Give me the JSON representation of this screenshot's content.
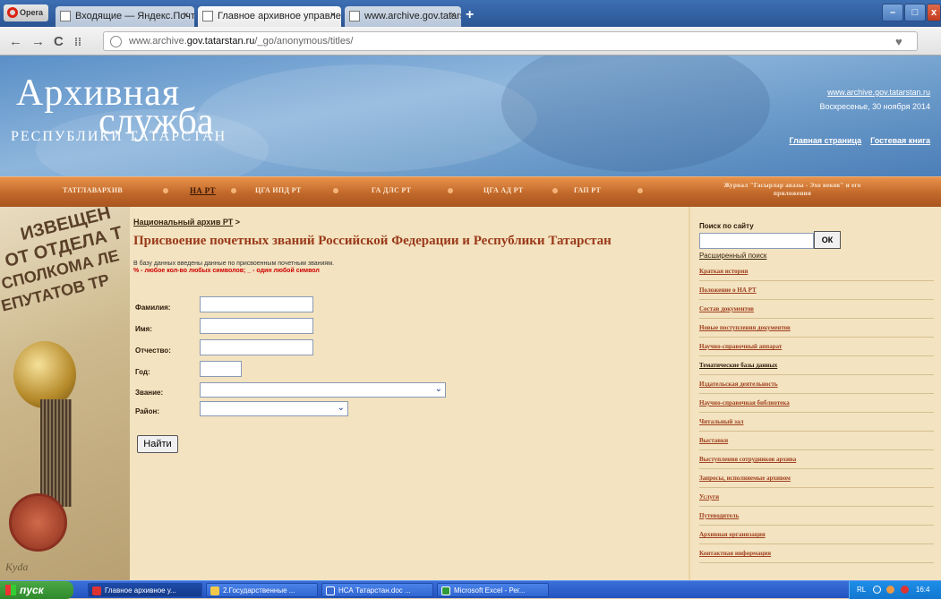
{
  "browser": {
    "opera_label": "Opera",
    "tabs": [
      {
        "label": "Входящие — Яндекс.Почта",
        "active": false
      },
      {
        "label": "Главное архивное управле",
        "active": true
      },
      {
        "label": "www.archive.gov.tatarstan",
        "active": false
      }
    ],
    "new_tab": "+",
    "url_prefix": "www.archive.",
    "url_domain": "gov.tatarstan.ru",
    "url_path": "/_go/anonymous/titles/",
    "heart": "♥",
    "win_min": "–",
    "win_max": "□",
    "win_close": "x",
    "back": "←",
    "forward": "→",
    "reload": "C",
    "speed_dial": "⁞⁞"
  },
  "banner": {
    "logo_line1": "Архивная",
    "logo_line2": "служба",
    "logo_line3": "РЕСПУБЛИКИ  ТАТАРСТАН",
    "site_url": "www.archive.gov.tatarstan.ru",
    "date": "Воскресенье, 30 ноября 2014",
    "home_link": "Главная страница",
    "guestbook_link": "Гостевая книга"
  },
  "menu": [
    {
      "label": "ТАТГЛАВАРХИВ",
      "current": false
    },
    {
      "label": "НА РТ",
      "current": true
    },
    {
      "label": "ЦГА ИПД РТ",
      "current": false
    },
    {
      "label": "ГА ДЛС РТ",
      "current": false
    },
    {
      "label": "ЦГА АД РТ",
      "current": false
    },
    {
      "label": "ГАП РТ",
      "current": false
    }
  ],
  "menu_journal": "Журнал \"Гасырлар авазы - Эхо веков\" и его приложения",
  "left_image": {
    "text_lines": [
      "ИЗВЕЩЕН",
      "ОТ ОТДЕЛА Т",
      "СПОЛКОМА ЛЕ",
      "ЕПУТАТОВ ТР"
    ],
    "caption": "Kyda"
  },
  "main": {
    "breadcrumb": "Национальный архив РТ",
    "breadcrumb_sep": " >",
    "title": "Присвоение почетных званий Российской Федерации и Республики Татарстан",
    "info": "В базу данных введены данные по присвоенным почетным званиям.",
    "note": "% - любое кол-во любых символов; _ - один любой символ",
    "fields": {
      "surname_label": "Фамилия:",
      "name_label": "Имя:",
      "patronymic_label": "Отчество:",
      "year_label": "Год:",
      "title_label": "Звание:",
      "district_label": "Район:"
    },
    "submit": "Найти"
  },
  "sidebar": {
    "search_heading": "Поиск по сайту",
    "ok": "ОК",
    "advanced": "Расширенный поиск",
    "items": [
      {
        "label": "Краткая история",
        "current": false
      },
      {
        "label": "Положение о НА РТ",
        "current": false
      },
      {
        "label": "Состав документов",
        "current": false
      },
      {
        "label": "Новые поступления документов",
        "current": false
      },
      {
        "label": "Научно-справочный аппарат",
        "current": false
      },
      {
        "label": "Тематические базы данных",
        "current": true
      },
      {
        "label": "Издательская деятельность",
        "current": false
      },
      {
        "label": "Научно-справочная библиотека",
        "current": false
      },
      {
        "label": "Читальный зал",
        "current": false
      },
      {
        "label": "Выставки",
        "current": false
      },
      {
        "label": "Выступления сотрудников архива",
        "current": false
      },
      {
        "label": "Запросы, исполняемые архивом",
        "current": false
      },
      {
        "label": "Услуги",
        "current": false
      },
      {
        "label": "Путеводитель",
        "current": false
      },
      {
        "label": "Архивная организация",
        "current": false
      },
      {
        "label": "Контактная информация",
        "current": false
      }
    ]
  },
  "taskbar": {
    "start": "пуск",
    "tasks": [
      {
        "label": "Главное архивное у...",
        "active": true
      },
      {
        "label": "2.Государственные ...",
        "active": false
      },
      {
        "label": "НСА Татарстан.doc ...",
        "active": false
      },
      {
        "label": "Microsoft Excel - Рег...",
        "active": false
      }
    ],
    "tray": "RL",
    "time": "16:4"
  }
}
